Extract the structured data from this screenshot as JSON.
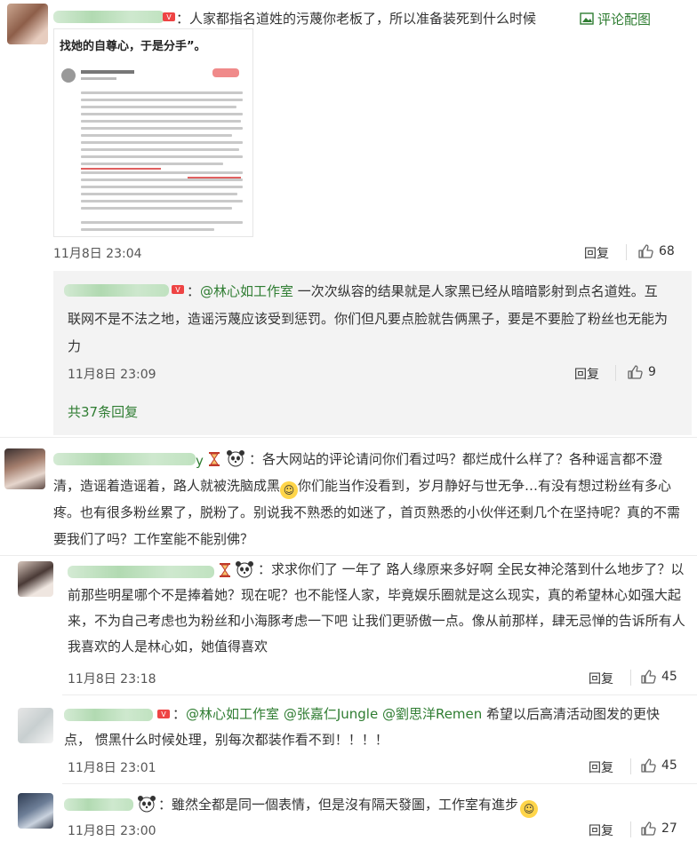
{
  "comments": [
    {
      "id": "c1",
      "text_prefix": "：",
      "text": "人家都指名道姓的污蔑你老板了，所以准备装死到什么时候",
      "action_label": "评论配图",
      "image_caption": "找她的自尊心，于是分手”。",
      "time": "11月8日 23:04",
      "reply_label": "回复",
      "likes": "68",
      "subreplies": [
        {
          "mention": "@林心如工作室",
          "text": " 一次次纵容的结果就是人家黑已经从暗暗影射到点名道姓。互联网不是不法之地，造谣污蔑应该受到惩罚。你们但凡要点脸就告俩黑子，要是不要脸了粉丝也无能为力",
          "time": "11月8日 23:09",
          "reply_label": "回复",
          "likes": "9"
        }
      ],
      "more_replies": "共37条回复"
    },
    {
      "id": "c2",
      "name_tail": "y",
      "text_prefix": "：",
      "text_a": "各大网站的评论请问你们看过吗？都烂成什么样了？各种谣言都不澄清，造谣着造谣着，路人就被洗脑成黑",
      "text_b": "你们能当作没看到，岁月静好与世无争…有没有想过粉丝有多心疼。也有很多粉丝累了，脱粉了。别说我不熟悉的如迷了，首页熟悉的小伙伴还剩几个在坚持呢？真的不需要我们了吗？工作室能不能别佛？"
    },
    {
      "id": "c3",
      "text_prefix": "：",
      "text": "求求你们了 一年了 路人缘原来多好啊 全民女神沦落到什么地步了？以前那些明星哪个不是捧着她？现在呢？也不能怪人家，毕竟娱乐圈就是这么现实，真的希望林心如强大起来，不为自己考虑也为粉丝和小海豚考虑一下吧 让我们更骄傲一点。像从前那样，肆无忌惮的告诉所有人我喜欢的人是林心如，她值得喜欢",
      "time": "11月8日 23:18",
      "reply_label": "回复",
      "likes": "45"
    },
    {
      "id": "c4",
      "text_prefix": "：",
      "mentions": [
        "@林心如工作室",
        "@张嘉仁Jungle",
        "@劉思洋Remen"
      ],
      "text": " 希望以后高清活动图发的更快点， 惯黑什么时候处理，别每次都装作看不到！！！！",
      "time": "11月8日 23:01",
      "reply_label": "回复",
      "likes": "45"
    },
    {
      "id": "c5",
      "text_prefix": "：",
      "text": "雖然全都是同一個表情，但是沒有隔天發圖，工作室有進步",
      "time": "11月8日 23:00",
      "reply_label": "回复",
      "likes": "27"
    }
  ],
  "colors": {
    "link": "#2f7d32",
    "sub_bg": "#f3f3f3",
    "text": "#333333"
  }
}
